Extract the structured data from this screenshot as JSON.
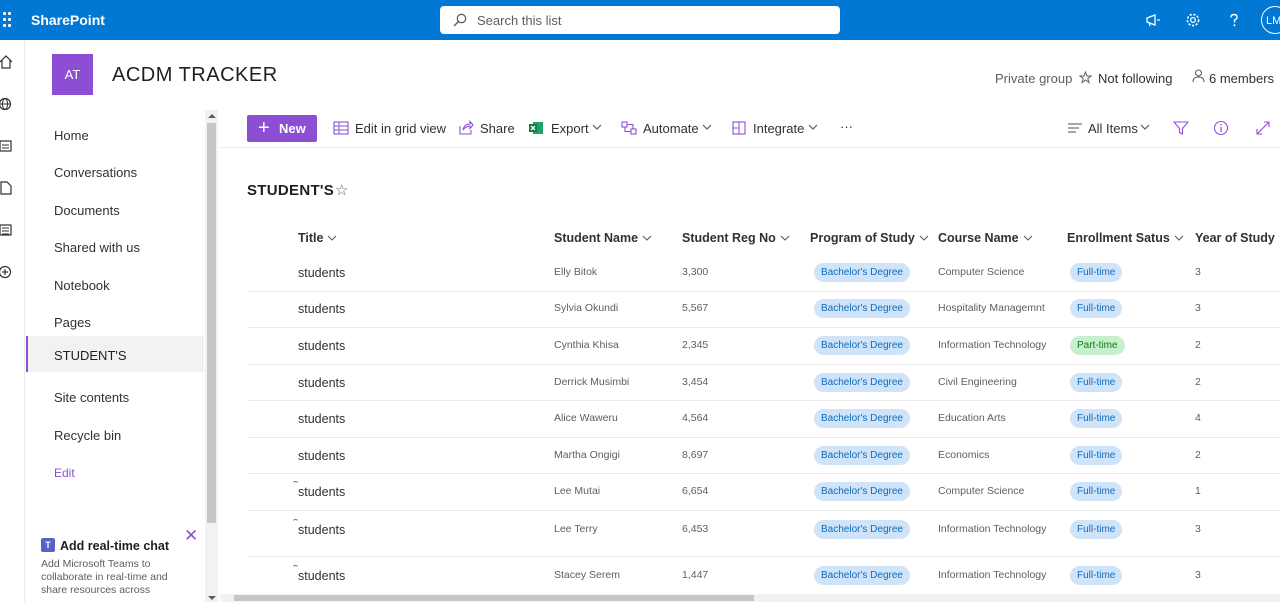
{
  "topbar": {
    "brand": "SharePoint",
    "search_placeholder": "Search this list",
    "avatar_initials": "LM",
    "icons": [
      "waffle-icon",
      "megaphone-icon",
      "gear-icon",
      "help-icon"
    ]
  },
  "site": {
    "logo_initials": "AT",
    "title": "ACDM TRACKER",
    "privacy": "Private group",
    "follow_label": "Not following",
    "members_label": "6 members"
  },
  "nav": {
    "items": [
      {
        "label": "Home"
      },
      {
        "label": "Conversations"
      },
      {
        "label": "Documents"
      },
      {
        "label": "Shared with us"
      },
      {
        "label": "Notebook"
      },
      {
        "label": "Pages"
      },
      {
        "label": "STUDENT'S",
        "active": true
      },
      {
        "label": "Site contents"
      },
      {
        "label": "Recycle bin"
      }
    ],
    "edit_label": "Edit"
  },
  "chat_card": {
    "title": "Add real-time chat",
    "description": "Add Microsoft Teams to collaborate in real-time and share resources across"
  },
  "commandbar": {
    "new_label": "New",
    "grid_label": "Edit in grid view",
    "share_label": "Share",
    "export_label": "Export",
    "automate_label": "Automate",
    "integrate_label": "Integrate",
    "more_label": "···",
    "view_label": "All Items"
  },
  "list": {
    "title": "STUDENT'S",
    "columns": [
      "Title",
      "Student Name",
      "Student Reg No",
      "Program of Study",
      "Course Name",
      "Enrollment Satus",
      "Year of Study"
    ],
    "rows": [
      {
        "title": "students",
        "name": "Elly Bitok",
        "reg": "3,300",
        "program": "Bachelor's Degree",
        "course": "Computer Science",
        "enrollment": "Full-time",
        "year": "3",
        "new": false
      },
      {
        "title": "students",
        "name": "Sylvia Okundi",
        "reg": "5,567",
        "program": "Bachelor's Degree",
        "course": "Hospitality Managemnt",
        "enrollment": "Full-time",
        "year": "3",
        "new": false
      },
      {
        "title": "students",
        "name": "Cynthia Khisa",
        "reg": "2,345",
        "program": "Bachelor's Degree",
        "course": "Information Technology",
        "enrollment": "Part-time",
        "year": "2",
        "new": false
      },
      {
        "title": "students",
        "name": "Derrick Musimbi",
        "reg": "3,454",
        "program": "Bachelor's Degree",
        "course": "Civil Engineering",
        "enrollment": "Full-time",
        "year": "2",
        "new": false
      },
      {
        "title": "students",
        "name": "Alice Waweru",
        "reg": "4,564",
        "program": "Bachelor's Degree",
        "course": "Education Arts",
        "enrollment": "Full-time",
        "year": "4",
        "new": false
      },
      {
        "title": "students",
        "name": "Martha Ongigi",
        "reg": "8,697",
        "program": "Bachelor's Degree",
        "course": "Economics",
        "enrollment": "Full-time",
        "year": "2",
        "new": false
      },
      {
        "title": "students",
        "name": "Lee Mutai",
        "reg": "6,654",
        "program": "Bachelor's Degree",
        "course": "Computer Science",
        "enrollment": "Full-time",
        "year": "1",
        "new": true
      },
      {
        "title": "students",
        "name": "Lee Terry",
        "reg": "6,453",
        "program": "Bachelor's Degree",
        "course": "Information Technology",
        "enrollment": "Full-time",
        "year": "3",
        "new": true
      },
      {
        "title": "students",
        "name": "Stacey Serem",
        "reg": "1,447",
        "program": "Bachelor's Degree",
        "course": "Information Technology",
        "enrollment": "Full-time",
        "year": "3",
        "new": true
      }
    ]
  },
  "colors": {
    "suite_bar": "#0078d4",
    "accent": "#8c4fd4",
    "pill_blue_bg": "#cfe4f8",
    "pill_blue_text": "#0f6cbd",
    "pill_green_bg": "#c6efce",
    "pill_green_text": "#107c10"
  }
}
